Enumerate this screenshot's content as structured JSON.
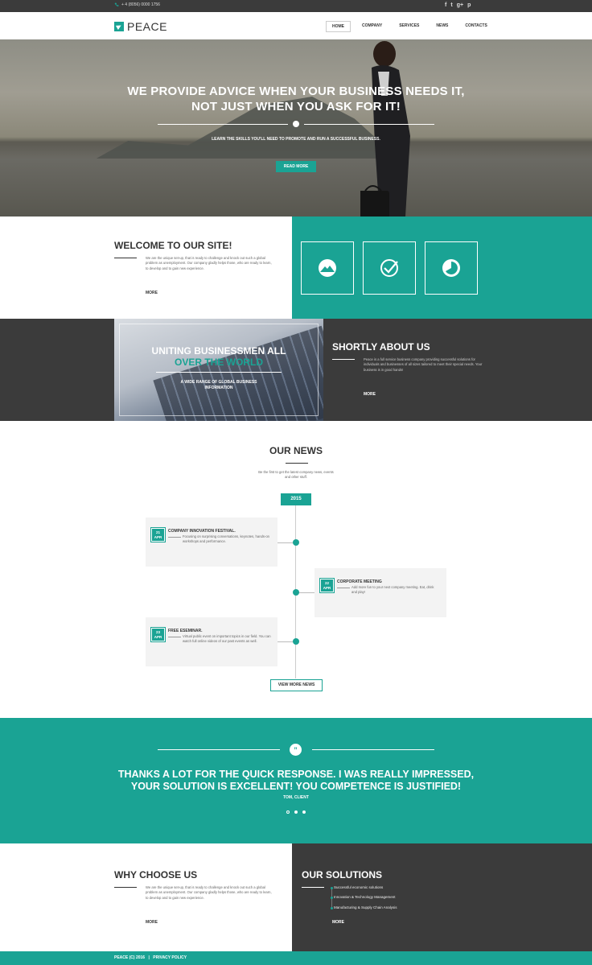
{
  "topbar": {
    "phone": "+ 4 (8056) 0000 1756",
    "social_icons": [
      "facebook-icon",
      "twitter-icon",
      "google-plus-icon",
      "pinterest-icon"
    ],
    "social_glyphs": [
      "f",
      "t",
      "g+",
      "p"
    ]
  },
  "header": {
    "logo_text": "PEACE",
    "nav": [
      {
        "label": "HOME",
        "active": true
      },
      {
        "label": "COMPANY",
        "active": false
      },
      {
        "label": "SERVICES",
        "active": false
      },
      {
        "label": "NEWS",
        "active": false
      },
      {
        "label": "CONTACTS",
        "active": false
      }
    ]
  },
  "hero": {
    "title_line1": "WE PROVIDE ADVICE WHEN YOUR BUSINESS NEEDS IT,",
    "title_line2": "NOT JUST WHEN YOU ASK FOR IT!",
    "subtitle": "LEARN THE SKILLS YOU'LL NEED TO PROMOTE AND RUN A SUCCESSFUL BUSINESS.",
    "button": "READ MORE"
  },
  "welcome": {
    "title": "WELCOME TO OUR SITE!",
    "text": "We are the unique set-up, that is ready to challenge and knock out such a global problem as unemployment. Our company gladly helps those, who are ready to learn, to develop and to gain new experience.",
    "more": "MORE",
    "feature_icons": [
      "mountain-icon",
      "checkmark-icon",
      "chart-icon"
    ]
  },
  "uniting": {
    "line1": "UNITING BUSINESSMEN ALL",
    "line2": "OVER THE WORLD",
    "sub": "A WIDE RANGE OF GLOBAL BUSINESS INFORMATION"
  },
  "about": {
    "title": "SHORTLY ABOUT US",
    "text": "Peace is a full service business company providing successful solutions for individuals and businesses of all sizes tailored to meet their special needs. Your business is in good hands!",
    "more": "MORE"
  },
  "news": {
    "title": "OUR NEWS",
    "intro": "Be the first to get the latest company news, events and other stuff.",
    "year": "2015",
    "items": [
      {
        "day": "21",
        "month": "APR",
        "title": "COMPANY INNOVATION FESTIVAL.",
        "text": "Focusing on surprising conversations, keynotes, hands-on workshops and performance."
      },
      {
        "day": "22",
        "month": "APR",
        "title": "CORPORATE MEETING",
        "text": "Add more fun to your next company meeting. Eat, drink and play!"
      },
      {
        "day": "23",
        "month": "APR",
        "title": "FREE ESEMINAR.",
        "text": "Virtual public event on important topics in our field. You can watch full online videos of our past events as well."
      }
    ],
    "button": "VIEW MORE NEWS"
  },
  "testimonial": {
    "quote_mark": "”",
    "line1": "THANKS A LOT FOR THE QUICK RESPONSE. I WAS REALLY IMPRESSED,",
    "line2": "YOUR SOLUTION IS EXCELLENT! YOU COMPETENCE IS JUSTIFIED!",
    "author": "TOM, CLIENT"
  },
  "why": {
    "title": "WHY CHOOSE US",
    "text": "We are the unique set-up, that is ready to challenge and knock out such a global problem as unemployment. Our company gladly helps those, who are ready to learn, to develop and to gain new experience.",
    "more": "MORE"
  },
  "solutions": {
    "title": "OUR SOLUTIONS",
    "items": [
      "Successful economic solutions",
      "Innovation & Technology Management",
      "Manufacturing & Supply Chain Analysis"
    ],
    "more": "MORE"
  },
  "footer": {
    "copyright": "PEACE (C) 2016",
    "separator": "|",
    "privacy": "PRIVACY POLICY"
  },
  "colors": {
    "accent": "#1aa394",
    "dark": "#3b3b3b"
  }
}
